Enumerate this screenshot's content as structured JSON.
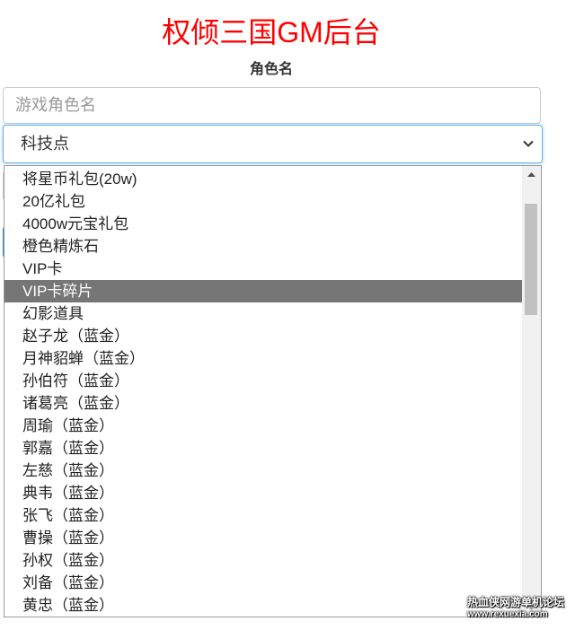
{
  "page": {
    "title": "权倾三国GM后台"
  },
  "form": {
    "role_label": "角色名",
    "role_input": {
      "placeholder": "游戏角色名",
      "value": ""
    },
    "item_select": {
      "selected": "科技点"
    }
  },
  "dropdown": {
    "options": [
      "将星币礼包(20w)",
      "20亿礼包",
      "4000w元宝礼包",
      "橙色精炼石",
      "VIP卡",
      "VIP卡碎片",
      "幻影道具",
      "赵子龙（蓝金）",
      "月神貂蝉（蓝金）",
      "孙伯符（蓝金）",
      "诸葛亮（蓝金）",
      "周瑜（蓝金）",
      "郭嘉（蓝金）",
      "左慈（蓝金）",
      "典韦（蓝金）",
      "张飞（蓝金）",
      "曹操（蓝金）",
      "孙权（蓝金）",
      "刘备（蓝金）",
      "黄忠（蓝金）"
    ],
    "highlighted_option": "VIP卡碎片",
    "scroll_position": 0.08
  },
  "watermark": {
    "line1": "热血侠网游单机论坛",
    "line2": "www.rexuexia.com"
  },
  "colors": {
    "title": "#ff0000",
    "highlight": "#767676",
    "focus_border": "#66afe9"
  }
}
